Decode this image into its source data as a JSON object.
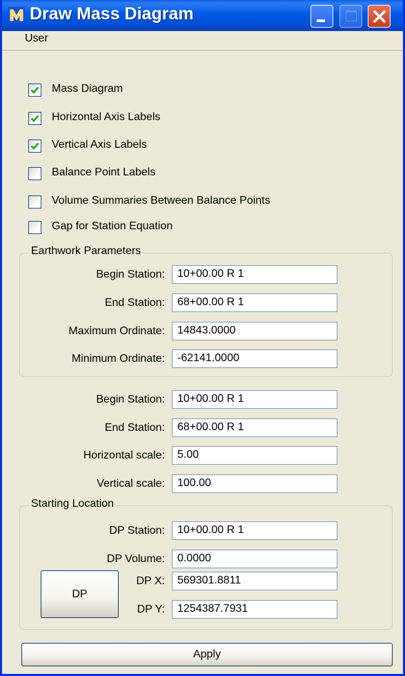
{
  "window": {
    "title": "Draw Mass Diagram",
    "icon": "microstation-m-icon",
    "title_color": "#0058e6",
    "close_color": "#e1552f"
  },
  "menu": {
    "items": [
      "User"
    ]
  },
  "options": [
    {
      "label": "Mass Diagram",
      "checked": true
    },
    {
      "label": "Horizontal Axis Labels",
      "checked": true
    },
    {
      "label": "Vertical Axis Labels",
      "checked": true
    },
    {
      "label": "Balance Point Labels",
      "checked": false
    },
    {
      "label": "Volume Summaries Between Balance Points",
      "checked": false
    },
    {
      "label": "Gap for Station Equation",
      "checked": false
    }
  ],
  "earthwork": {
    "title": "Earthwork Parameters",
    "fields": [
      {
        "label": "Begin Station:",
        "value": "10+00.00 R 1"
      },
      {
        "label": "End Station:",
        "value": "68+00.00 R 1"
      },
      {
        "label": "Maximum Ordinate:",
        "value": "14843.0000"
      },
      {
        "label": "Minimum Ordinate:",
        "value": "-62141.0000"
      }
    ]
  },
  "diagram": {
    "fields": [
      {
        "label": "Begin Station:",
        "value": "10+00.00 R 1"
      },
      {
        "label": "End Station:",
        "value": "68+00.00 R 1"
      },
      {
        "label": "Horizontal scale:",
        "value": "5.00"
      },
      {
        "label": "Vertical scale:",
        "value": "100.00"
      }
    ]
  },
  "starting": {
    "title": "Starting Location",
    "fields": [
      {
        "label": "DP Station:",
        "value": "10+00.00 R 1"
      },
      {
        "label": "DP Volume:",
        "value": "0.0000"
      }
    ],
    "dp_button": "DP",
    "dp_x": {
      "label": "DP X:",
      "value": "569301.8811"
    },
    "dp_y": {
      "label": "DP Y:",
      "value": "1254387.7931"
    }
  },
  "apply_label": "Apply",
  "check_color": "#21a121"
}
